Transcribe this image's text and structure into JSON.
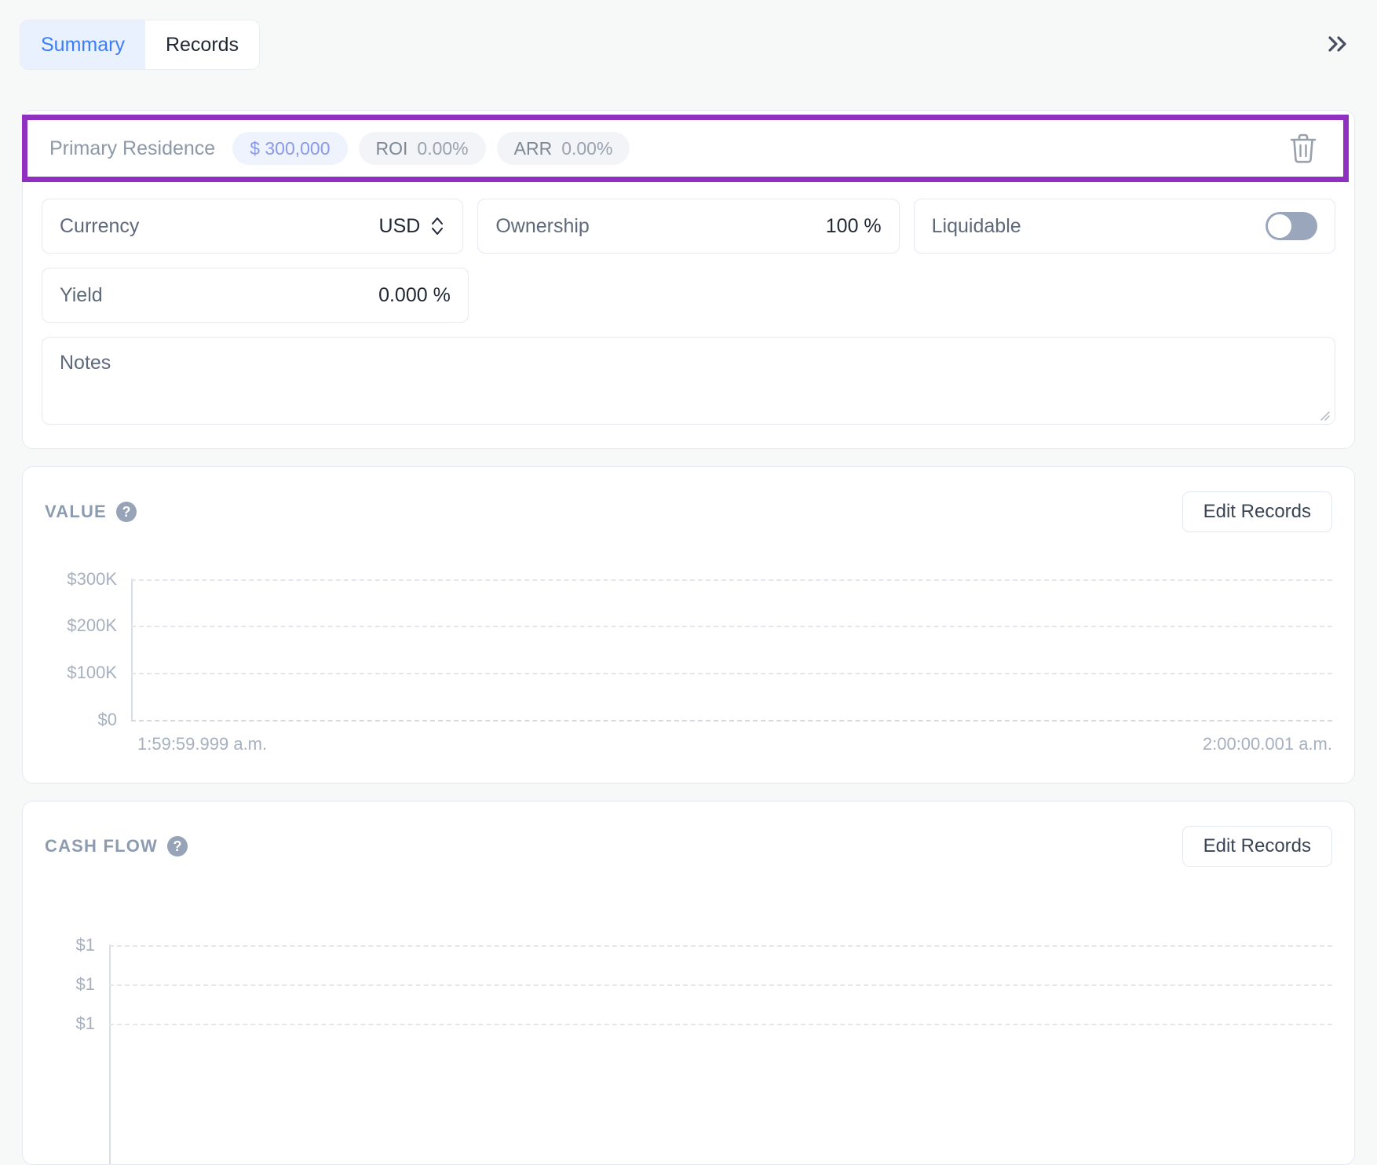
{
  "topbar": {
    "tabs": [
      {
        "label": "Summary",
        "active": true
      },
      {
        "label": "Records",
        "active": false
      }
    ],
    "collapse_icon": "chevron-double-right-icon"
  },
  "asset": {
    "name": "Primary Residence",
    "value_pill": "$ 300,000",
    "roi_label": "ROI",
    "roi_value": "0.00%",
    "arr_label": "ARR",
    "arr_value": "0.00%",
    "delete_icon": "trash-icon",
    "highlight_color": "#9030c0"
  },
  "form": {
    "currency": {
      "label": "Currency",
      "value": "USD",
      "icon": "stepper-updown-icon"
    },
    "ownership": {
      "label": "Ownership",
      "value": "100 %"
    },
    "liquidable": {
      "label": "Liquidable",
      "enabled": false
    },
    "yield": {
      "label": "Yield",
      "value": "0.000 %"
    },
    "notes": {
      "placeholder": "Notes",
      "value": ""
    }
  },
  "value_section": {
    "title": "VALUE",
    "help": "?",
    "edit_label": "Edit Records"
  },
  "cash_section": {
    "title": "CASH FLOW",
    "help": "?",
    "edit_label": "Edit Records"
  },
  "chart_data": [
    {
      "type": "line",
      "title": "VALUE",
      "xlabel": "",
      "ylabel": "",
      "series": [
        {
          "name": "Value",
          "values": []
        }
      ],
      "x": [],
      "yticks": [
        "$300K",
        "$200K",
        "$100K",
        "$0"
      ],
      "ylim": [
        0,
        300000
      ],
      "xticks": [
        "1:59:59.999 a.m.",
        "2:00:00.001 a.m."
      ],
      "grid": true,
      "legend": "none"
    },
    {
      "type": "line",
      "title": "CASH FLOW",
      "xlabel": "",
      "ylabel": "",
      "series": [
        {
          "name": "Cash Flow",
          "values": []
        }
      ],
      "x": [],
      "yticks": [
        "$1",
        "$1",
        "$1"
      ],
      "ylim": [
        1,
        1
      ],
      "xticks": [],
      "grid": true,
      "legend": "none"
    }
  ]
}
